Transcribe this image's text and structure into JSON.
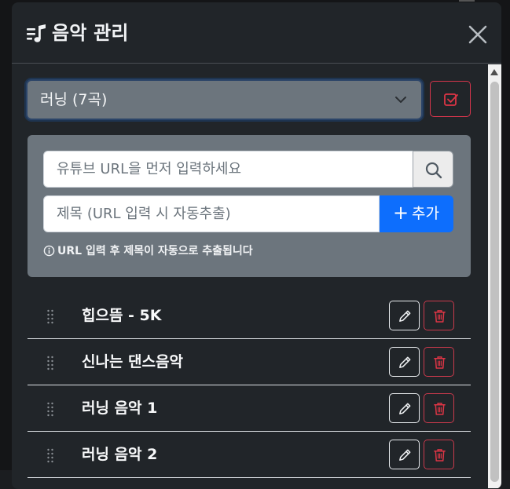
{
  "modal": {
    "title": "음악 관리",
    "title_icon": "playlist-music-icon",
    "close_icon": "close-icon"
  },
  "playlist": {
    "selected": "러닝 (7곡)",
    "confirm_icon": "check-square-icon"
  },
  "add_song": {
    "url_placeholder": "유튜브 URL을 먼저 입력하세요",
    "title_placeholder": "제목 (URL 입력 시 자동추출)",
    "add_label": "추가",
    "add_icon": "plus-icon",
    "search_icon": "search-icon",
    "hint": "URL 입력 후 제목이 자동으로 추출됩니다",
    "hint_icon": "info-circle-icon"
  },
  "songs": [
    {
      "title": "힙으뜸 - 5K"
    },
    {
      "title": "신나는 댄스음악"
    },
    {
      "title": "러닝 음악 1"
    },
    {
      "title": "러닝 음악 2"
    }
  ],
  "colors": {
    "accent": "#0d6efd",
    "danger": "#dc3545",
    "modal_bg": "#212529",
    "panel_bg": "#6c757d"
  }
}
